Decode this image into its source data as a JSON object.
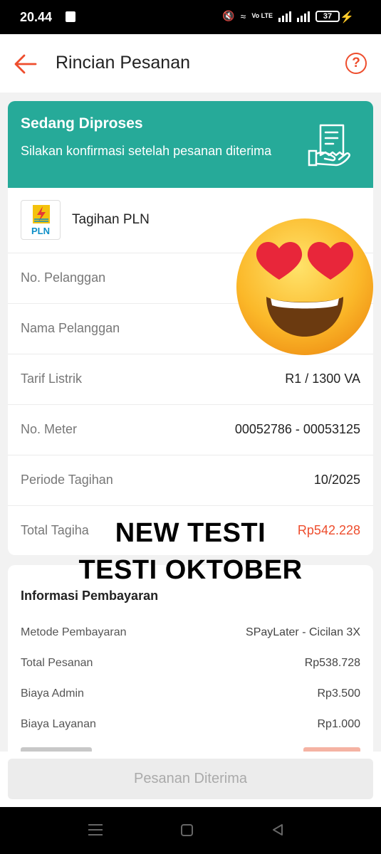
{
  "status_bar": {
    "time": "20.44",
    "battery": "37",
    "network": "Vo LTE"
  },
  "header": {
    "title": "Rincian Pesanan"
  },
  "status_card": {
    "title": "Sedang Diproses",
    "description": "Silakan konfirmasi setelah pesanan diterima"
  },
  "product": {
    "logo_text": "PLN",
    "name": "Tagihan PLN"
  },
  "info_rows": [
    {
      "label": "No. Pelanggan",
      "value": ""
    },
    {
      "label": "Nama Pelanggan",
      "value": ""
    },
    {
      "label": "Tarif Listrik",
      "value": "R1 / 1300 VA"
    },
    {
      "label": "No. Meter",
      "value": "00052786 - 00053125"
    },
    {
      "label": "Periode Tagihan",
      "value": "10/2025"
    },
    {
      "label": "Total Tagiha",
      "value": "Rp542.228"
    }
  ],
  "payment": {
    "title": "Informasi Pembayaran",
    "rows": [
      {
        "label": "Metode Pembayaran",
        "value": "SPayLater - Cicilan 3X"
      },
      {
        "label": "Total Pesanan",
        "value": "Rp538.728"
      },
      {
        "label": "Biaya Admin",
        "value": "Rp3.500"
      },
      {
        "label": "Biaya Layanan",
        "value": "Rp1.000"
      }
    ]
  },
  "bottom": {
    "button_label": "Pesanan Diterima"
  },
  "overlay": {
    "line1": "NEW TESTI",
    "line2": "TESTI OKTOBER"
  },
  "colors": {
    "accent": "#ee4d2d",
    "status_green": "#26aa99"
  },
  "icons": [
    "back-arrow-icon",
    "help-icon",
    "receipt-hand-icon",
    "heart-eyes-emoji"
  ]
}
